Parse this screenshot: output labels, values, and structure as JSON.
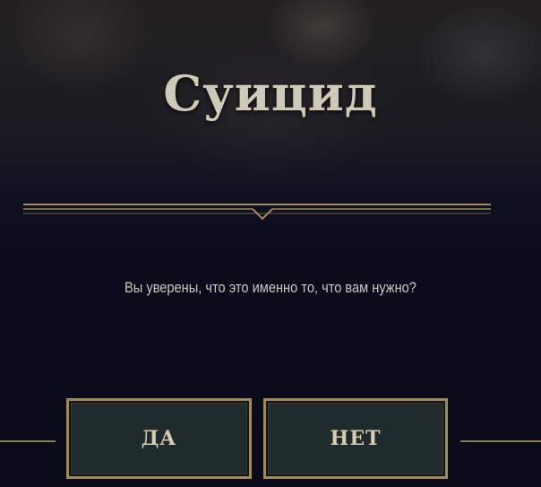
{
  "dialog": {
    "title": "Суицид",
    "question": "Вы уверены, что это именно то, что вам нужно?",
    "yes_label": "ДА",
    "no_label": "НЕТ"
  },
  "colors": {
    "gold_trim": "#a08a5c",
    "button_bg": "#1f2b2c",
    "title_text": "#cfc9b7",
    "background": "#090b18"
  }
}
